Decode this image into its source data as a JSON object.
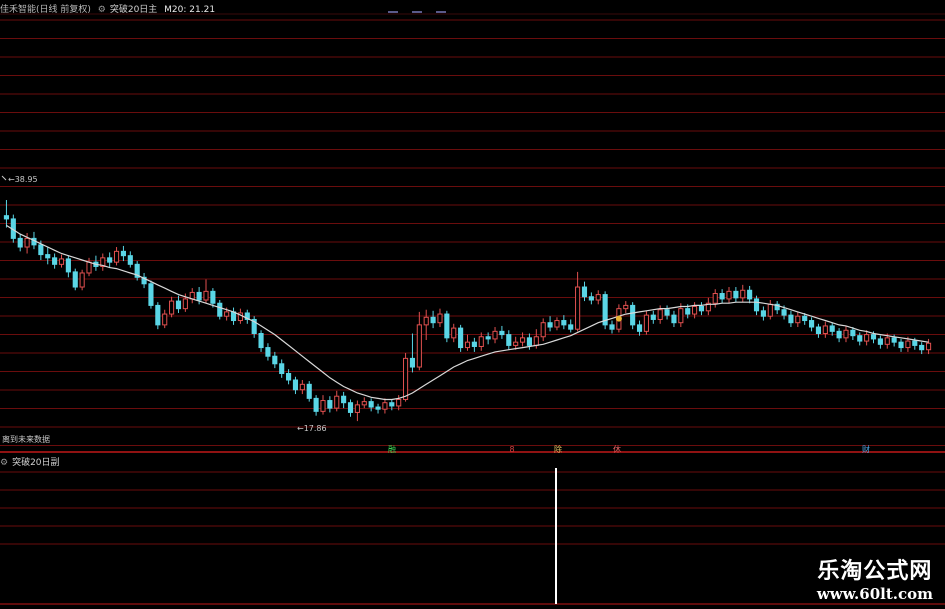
{
  "header": {
    "title": "佳禾智能(日线 前复权)",
    "indicator": "突破20日主",
    "ma_label": "M20: 21.21"
  },
  "sub_header": {
    "indicator": "突破20日副"
  },
  "annotations": {
    "high_label": "38.95",
    "low_label": "17.86",
    "future_note": "离到未来数据"
  },
  "markers": [
    {
      "label": "融",
      "color": "#39d353"
    },
    {
      "label": "8",
      "color": "#d04040"
    },
    {
      "label": "除",
      "color": "#e0c060"
    },
    {
      "label": "休",
      "color": "#e06060"
    },
    {
      "label": "财",
      "color": "#4fa8e8"
    }
  ],
  "watermark": {
    "text": "乐淘公式网",
    "url": "www.60lt.com"
  },
  "colors": {
    "up": "#e0504f",
    "down": "#5ad6e6",
    "ma": "#d8d8d8",
    "grid": "#6a0d0d",
    "divider": "#c01818",
    "signal": "#ffffff"
  },
  "chart_data": {
    "type": "candlestick",
    "series_name": "M20",
    "price_range": [
      17.86,
      38.95
    ],
    "candles": [
      [
        37.5,
        37.2,
        38.95,
        36.4
      ],
      [
        37.2,
        35.4,
        37.6,
        35.0
      ],
      [
        35.4,
        34.6,
        35.8,
        34.2
      ],
      [
        34.6,
        35.4,
        35.9,
        34.0
      ],
      [
        35.4,
        34.8,
        36.0,
        34.4
      ],
      [
        34.8,
        33.9,
        35.2,
        33.4
      ],
      [
        33.9,
        33.6,
        34.6,
        33.0
      ],
      [
        33.6,
        33.0,
        34.0,
        32.6
      ],
      [
        33.0,
        33.5,
        33.9,
        32.7
      ],
      [
        33.5,
        32.3,
        33.8,
        31.8
      ],
      [
        32.3,
        30.9,
        32.6,
        30.6
      ],
      [
        30.9,
        32.2,
        32.5,
        30.6
      ],
      [
        32.2,
        33.2,
        33.6,
        31.9
      ],
      [
        33.2,
        32.8,
        33.8,
        32.4
      ],
      [
        32.8,
        33.6,
        34.0,
        32.4
      ],
      [
        33.6,
        33.2,
        34.1,
        32.7
      ],
      [
        33.2,
        34.2,
        34.6,
        32.9
      ],
      [
        34.2,
        33.8,
        34.7,
        33.3
      ],
      [
        33.8,
        33.0,
        34.2,
        32.7
      ],
      [
        33.0,
        31.8,
        33.3,
        31.5
      ],
      [
        31.8,
        31.2,
        32.2,
        30.8
      ],
      [
        31.2,
        29.2,
        31.5,
        28.9
      ],
      [
        29.2,
        27.4,
        29.5,
        27.0
      ],
      [
        27.4,
        28.4,
        28.8,
        27.1
      ],
      [
        28.4,
        29.6,
        30.0,
        28.1
      ],
      [
        29.6,
        28.9,
        30.1,
        28.5
      ],
      [
        28.9,
        29.8,
        30.3,
        28.6
      ],
      [
        29.8,
        30.4,
        30.8,
        29.4
      ],
      [
        30.4,
        29.7,
        30.9,
        29.3
      ],
      [
        29.7,
        30.5,
        31.6,
        29.4
      ],
      [
        30.5,
        29.4,
        30.8,
        29.0
      ],
      [
        29.4,
        28.2,
        29.7,
        27.9
      ],
      [
        28.2,
        28.6,
        29.0,
        27.8
      ],
      [
        28.6,
        27.8,
        29.0,
        27.4
      ],
      [
        27.8,
        28.5,
        28.9,
        27.5
      ],
      [
        28.5,
        27.9,
        28.8,
        27.5
      ],
      [
        27.9,
        26.6,
        28.2,
        26.2
      ],
      [
        26.6,
        25.3,
        26.9,
        24.9
      ],
      [
        25.3,
        24.5,
        25.7,
        24.1
      ],
      [
        24.5,
        23.8,
        24.9,
        23.4
      ],
      [
        23.8,
        22.9,
        24.2,
        22.5
      ],
      [
        22.9,
        22.3,
        23.3,
        21.9
      ],
      [
        22.3,
        21.4,
        22.6,
        21.0
      ],
      [
        21.4,
        21.9,
        22.3,
        21.0
      ],
      [
        21.9,
        20.6,
        22.2,
        20.3
      ],
      [
        20.6,
        19.4,
        20.9,
        19.0
      ],
      [
        19.4,
        20.4,
        20.9,
        19.1
      ],
      [
        20.4,
        19.7,
        20.8,
        19.3
      ],
      [
        19.7,
        20.8,
        21.3,
        19.4
      ],
      [
        20.8,
        20.2,
        21.2,
        19.7
      ],
      [
        20.2,
        19.3,
        20.5,
        18.9
      ],
      [
        19.3,
        20.0,
        20.4,
        18.5
      ],
      [
        20.0,
        20.3,
        20.7,
        19.7
      ],
      [
        20.3,
        19.8,
        20.6,
        19.4
      ],
      [
        19.8,
        19.6,
        20.1,
        19.2
      ],
      [
        19.6,
        20.2,
        20.6,
        19.2
      ],
      [
        20.2,
        19.9,
        20.5,
        19.5
      ],
      [
        19.9,
        20.5,
        20.9,
        19.5
      ],
      [
        20.5,
        24.3,
        24.8,
        20.3
      ],
      [
        24.3,
        23.5,
        26.6,
        23.0
      ],
      [
        23.5,
        27.4,
        28.6,
        23.2
      ],
      [
        27.4,
        28.1,
        28.8,
        26.0
      ],
      [
        28.1,
        27.6,
        28.7,
        27.1
      ],
      [
        27.6,
        28.4,
        28.9,
        27.2
      ],
      [
        28.4,
        26.2,
        28.7,
        25.8
      ],
      [
        26.2,
        27.1,
        27.5,
        25.8
      ],
      [
        27.1,
        25.3,
        27.4,
        24.9
      ],
      [
        25.3,
        25.8,
        26.5,
        25.0
      ],
      [
        25.8,
        25.4,
        26.2,
        24.9
      ],
      [
        25.4,
        26.3,
        26.7,
        25.0
      ],
      [
        26.3,
        26.1,
        26.7,
        25.6
      ],
      [
        26.1,
        26.8,
        27.2,
        25.7
      ],
      [
        26.8,
        26.5,
        27.3,
        26.1
      ],
      [
        26.5,
        25.5,
        26.9,
        25.1
      ],
      [
        25.5,
        25.8,
        26.3,
        25.1
      ],
      [
        25.8,
        26.2,
        26.7,
        25.4
      ],
      [
        26.2,
        25.5,
        26.6,
        25.1
      ],
      [
        25.5,
        26.3,
        27.0,
        25.2
      ],
      [
        26.3,
        27.6,
        28.0,
        25.9
      ],
      [
        27.6,
        27.2,
        28.2,
        26.8
      ],
      [
        27.2,
        27.8,
        28.1,
        26.9
      ],
      [
        27.8,
        27.4,
        28.3,
        27.0
      ],
      [
        27.4,
        27.0,
        27.9,
        26.7
      ],
      [
        27.0,
        30.9,
        32.3,
        26.8
      ],
      [
        30.9,
        30.0,
        31.4,
        29.6
      ],
      [
        30.0,
        29.7,
        30.4,
        29.3
      ],
      [
        29.7,
        30.2,
        30.6,
        29.3
      ],
      [
        30.2,
        27.4,
        30.5,
        27.0
      ],
      [
        27.4,
        27.0,
        27.8,
        26.6
      ],
      [
        27.0,
        28.9,
        29.3,
        26.7
      ],
      [
        28.9,
        29.2,
        29.6,
        28.5
      ],
      [
        29.2,
        27.4,
        29.5,
        27.0
      ],
      [
        27.4,
        26.8,
        27.8,
        26.4
      ],
      [
        26.8,
        28.3,
        28.7,
        26.5
      ],
      [
        28.3,
        27.9,
        28.7,
        27.5
      ],
      [
        27.9,
        28.8,
        29.2,
        27.5
      ],
      [
        28.8,
        28.3,
        29.2,
        27.9
      ],
      [
        28.3,
        27.6,
        28.7,
        27.2
      ],
      [
        27.6,
        28.9,
        29.4,
        27.2
      ],
      [
        28.9,
        28.4,
        29.3,
        28.0
      ],
      [
        28.4,
        29.1,
        29.5,
        28.0
      ],
      [
        29.1,
        28.7,
        29.5,
        28.3
      ],
      [
        28.7,
        29.4,
        29.9,
        28.3
      ],
      [
        29.4,
        30.3,
        30.7,
        29.0
      ],
      [
        30.3,
        29.8,
        30.7,
        29.4
      ],
      [
        29.8,
        30.5,
        30.9,
        29.4
      ],
      [
        30.5,
        29.9,
        30.9,
        29.5
      ],
      [
        29.9,
        30.6,
        31.1,
        29.5
      ],
      [
        30.6,
        29.8,
        31.0,
        29.4
      ],
      [
        29.8,
        28.7,
        30.1,
        28.3
      ],
      [
        28.7,
        28.2,
        29.1,
        27.8
      ],
      [
        28.2,
        29.3,
        29.7,
        27.9
      ],
      [
        29.3,
        28.8,
        29.6,
        28.4
      ],
      [
        28.8,
        28.3,
        29.2,
        27.9
      ],
      [
        28.3,
        27.6,
        28.7,
        27.2
      ],
      [
        27.6,
        28.2,
        28.6,
        27.2
      ],
      [
        28.2,
        27.8,
        28.5,
        27.4
      ],
      [
        27.8,
        27.2,
        28.1,
        26.8
      ],
      [
        27.2,
        26.6,
        27.5,
        26.2
      ],
      [
        26.6,
        27.3,
        27.7,
        26.2
      ],
      [
        27.3,
        26.8,
        27.6,
        26.4
      ],
      [
        26.8,
        26.2,
        27.1,
        25.8
      ],
      [
        26.2,
        26.9,
        27.3,
        25.8
      ],
      [
        26.9,
        26.4,
        27.2,
        26.0
      ],
      [
        26.4,
        25.9,
        26.7,
        25.5
      ],
      [
        25.9,
        26.5,
        26.9,
        25.5
      ],
      [
        26.5,
        26.1,
        26.8,
        25.7
      ],
      [
        26.1,
        25.6,
        26.4,
        25.2
      ],
      [
        25.6,
        26.2,
        26.6,
        25.2
      ],
      [
        26.2,
        25.8,
        26.5,
        25.4
      ],
      [
        25.8,
        25.3,
        26.1,
        24.9
      ],
      [
        25.3,
        25.9,
        26.3,
        24.9
      ],
      [
        25.9,
        25.5,
        26.2,
        25.1
      ],
      [
        25.5,
        25.1,
        25.8,
        24.7
      ],
      [
        25.1,
        25.7,
        26.1,
        24.7
      ]
    ],
    "ma20": [
      36.6,
      36.2,
      35.8,
      35.5,
      35.2,
      34.9,
      34.6,
      34.3,
      34.0,
      33.8,
      33.6,
      33.4,
      33.2,
      33.0,
      32.9,
      32.7,
      32.6,
      32.4,
      32.2,
      32.0,
      31.7,
      31.4,
      31.1,
      30.8,
      30.5,
      30.2,
      30.0,
      29.8,
      29.6,
      29.4,
      29.2,
      29.0,
      28.8,
      28.6,
      28.3,
      28.0,
      27.7,
      27.3,
      26.9,
      26.5,
      26.0,
      25.5,
      25.0,
      24.5,
      24.0,
      23.5,
      23.0,
      22.5,
      22.1,
      21.7,
      21.4,
      21.1,
      20.9,
      20.7,
      20.6,
      20.5,
      20.5,
      20.6,
      20.8,
      21.1,
      21.5,
      21.9,
      22.3,
      22.7,
      23.1,
      23.5,
      23.8,
      24.1,
      24.3,
      24.5,
      24.7,
      24.9,
      25.0,
      25.1,
      25.2,
      25.3,
      25.4,
      25.5,
      25.6,
      25.8,
      26.0,
      26.2,
      26.4,
      26.7,
      27.0,
      27.3,
      27.6,
      27.8,
      28.0,
      28.2,
      28.4,
      28.5,
      28.6,
      28.7,
      28.8,
      28.9,
      28.9,
      29.0,
      29.1,
      29.1,
      29.2,
      29.2,
      29.3,
      29.3,
      29.4,
      29.4,
      29.5,
      29.5,
      29.5,
      29.5,
      29.4,
      29.3,
      29.2,
      29.0,
      28.8,
      28.6,
      28.4,
      28.2,
      28.0,
      27.8,
      27.6,
      27.4,
      27.3,
      27.1,
      26.9,
      26.8,
      26.6,
      26.5,
      26.4,
      26.3,
      26.2,
      26.1,
      26.0,
      25.9,
      25.8
    ],
    "signal_bar_index": 89
  }
}
